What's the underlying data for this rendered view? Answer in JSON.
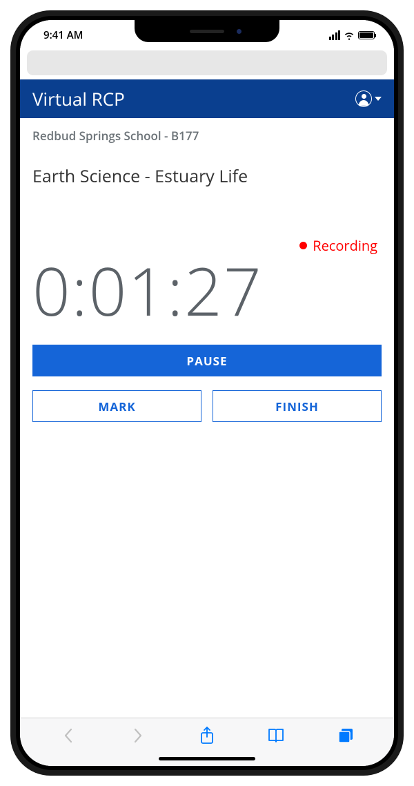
{
  "status": {
    "time": "9:41 AM"
  },
  "header": {
    "title": "Virtual RCP"
  },
  "breadcrumb": "Redbud Springs School - B177",
  "course_title": "Earth Science - Estuary Life",
  "recording": {
    "label": "Recording"
  },
  "timer": "0:01:27",
  "buttons": {
    "pause": "PAUSE",
    "mark": "MARK",
    "finish": "FINISH"
  },
  "colors": {
    "header_bg": "#0a3f8f",
    "primary": "#1565d8",
    "record": "#ff0000",
    "muted": "#6c7378"
  }
}
